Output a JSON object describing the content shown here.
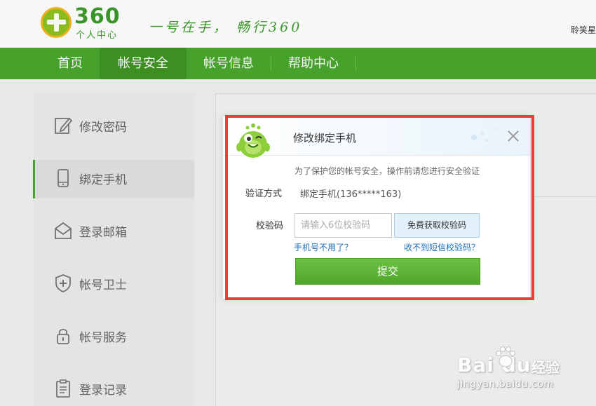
{
  "header": {
    "logo_number": "360",
    "logo_subtitle": "个人中心",
    "slogan": "一号在手， 畅行360",
    "user_name": "聆笑星"
  },
  "nav": {
    "items": [
      {
        "label": "首页"
      },
      {
        "label": "帐号安全"
      },
      {
        "label": "帐号信息"
      },
      {
        "label": "帮助中心"
      }
    ],
    "active_index": 1
  },
  "sidebar": {
    "items": [
      {
        "label": "修改密码",
        "icon": "edit-icon"
      },
      {
        "label": "绑定手机",
        "icon": "phone-icon"
      },
      {
        "label": "登录邮箱",
        "icon": "mail-icon"
      },
      {
        "label": "帐号卫士",
        "icon": "shield-icon"
      },
      {
        "label": "帐号服务",
        "icon": "lock-icon"
      },
      {
        "label": "登录记录",
        "icon": "clipboard-icon"
      }
    ],
    "active_index": 1
  },
  "dialog": {
    "title": "修改绑定手机",
    "notice": "为了保护您的帐号安全，操作前请您进行安全验证",
    "verify_method_label": "验证方式",
    "verify_method_value": "绑定手机(136*****163)",
    "code_label": "校验码",
    "code_placeholder": "请输入6位校验码",
    "code_value": "",
    "get_code_label": "免费获取校验码",
    "phone_unused_link": "手机号不用了？",
    "no_sms_link": "收不到短信校验码？",
    "submit_label": "提交"
  },
  "watermark": {
    "brand": "Bai du",
    "brand_cn": "经验",
    "url": "jingyan.baidu.com"
  },
  "colors": {
    "brand_green": "#4aa82d",
    "nav_active": "#3f9424",
    "link_blue": "#1a6fbf",
    "annotation_red": "#ee3b3b"
  }
}
